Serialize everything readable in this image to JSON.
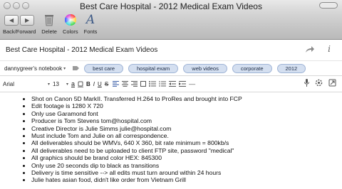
{
  "window": {
    "title": "Best Care Hospital - 2012 Medical Exam Videos"
  },
  "toolbar": {
    "back_forward_label": "Back/Forward",
    "delete_label": "Delete",
    "colors_label": "Colors",
    "fonts_label": "Fonts"
  },
  "note": {
    "title": "Best Care Hospital - 2012 Medical Exam Videos",
    "notebook": "dannygreer's notebook",
    "tags": [
      "best care",
      "hospital exam",
      "web videos",
      "corporate",
      "2012"
    ]
  },
  "format": {
    "font_family": "Arial",
    "font_size": "13",
    "underline_label": "a",
    "bold_label": "B",
    "italic_label": "I",
    "underline_btn_label": "U",
    "strike_label": "S"
  },
  "body_lines": [
    "Shot on Canon 5D MarkII.  Transferred H.264 to ProRes and brought into FCP",
    "Edit footage is 1280 X 720",
    "Only use Garamond font",
    "Producer is Tom Stevens tom@hospital.com",
    "Creative Director is Julie Simms julie@hospital.com",
    "Must include Tom and Julie on all correspondence.",
    "All deliverables should be WMVs, 640 X 360, bit rate minimum = 800kb/s",
    "All deliverables need to be uploaded to client FTP site, password \"medical\"",
    "All graphics should be brand color HEX: 845300",
    "Only use 20 seconds dip to black as transitions",
    "Delivery is time sensitive --> all edits must turn around within 24 hours",
    "Julie hates asian food, didn't like order from Vietnam Grill"
  ],
  "colors": {
    "tag_bg": "#d4dff0",
    "tag_border": "#9fb4d6",
    "text": "#111111"
  },
  "icons": [
    "back-icon",
    "forward-icon",
    "trash-icon",
    "color-wheel-icon",
    "fonts-icon",
    "share-icon",
    "info-icon",
    "notebook-icon",
    "font-color-icon",
    "microphone-icon",
    "attachment-icon",
    "link-icon"
  ]
}
